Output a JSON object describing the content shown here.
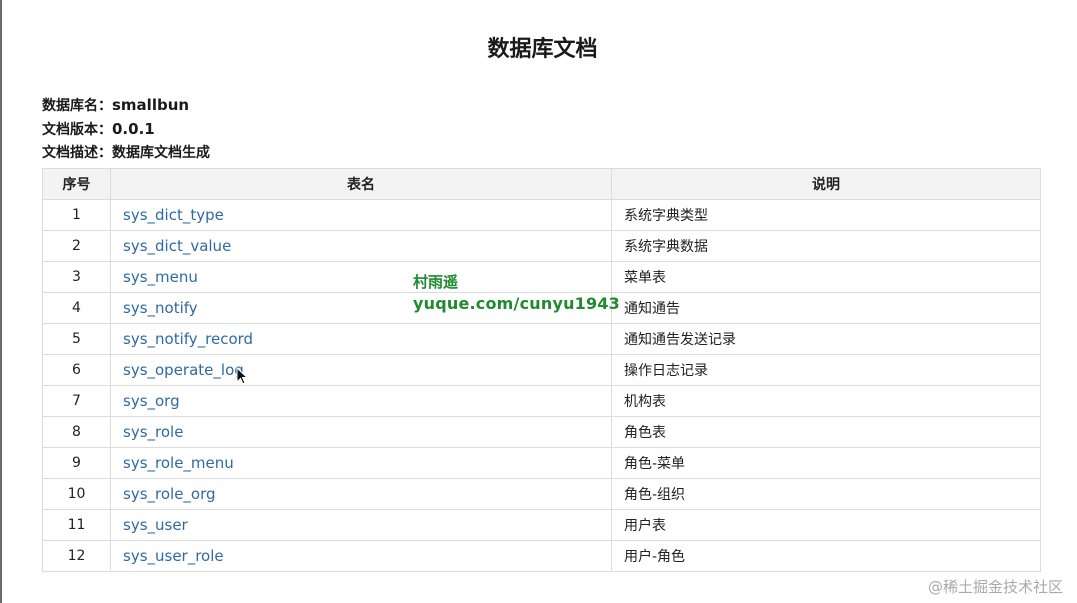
{
  "document": {
    "title": "数据库文档",
    "meta": {
      "db_name_label": "数据库名：",
      "db_name_value": "smallbun",
      "version_label": "文档版本：",
      "version_value": "0.0.1",
      "desc_label": "文档描述：",
      "desc_value": "数据库文档生成"
    },
    "table": {
      "headers": [
        "序号",
        "表名",
        "说明"
      ],
      "rows": [
        {
          "no": "1",
          "name": "sys_dict_type",
          "desc": "系统字典类型"
        },
        {
          "no": "2",
          "name": "sys_dict_value",
          "desc": "系统字典数据"
        },
        {
          "no": "3",
          "name": "sys_menu",
          "desc": "菜单表"
        },
        {
          "no": "4",
          "name": "sys_notify",
          "desc": "通知通告"
        },
        {
          "no": "5",
          "name": "sys_notify_record",
          "desc": "通知通告发送记录"
        },
        {
          "no": "6",
          "name": "sys_operate_log",
          "desc": "操作日志记录"
        },
        {
          "no": "7",
          "name": "sys_org",
          "desc": "机构表"
        },
        {
          "no": "8",
          "name": "sys_role",
          "desc": "角色表"
        },
        {
          "no": "9",
          "name": "sys_role_menu",
          "desc": "角色-菜单"
        },
        {
          "no": "10",
          "name": "sys_role_org",
          "desc": "角色-组织"
        },
        {
          "no": "11",
          "name": "sys_user",
          "desc": "用户表"
        },
        {
          "no": "12",
          "name": "sys_user_role",
          "desc": "用户-角色"
        }
      ]
    }
  },
  "overlay": {
    "watermark_line1": "村雨遥",
    "watermark_line2": "yuque.com/cunyu1943",
    "corner_watermark": "@稀土掘金技术社区"
  },
  "icons": {
    "cursor": "mouse-pointer-icon"
  }
}
